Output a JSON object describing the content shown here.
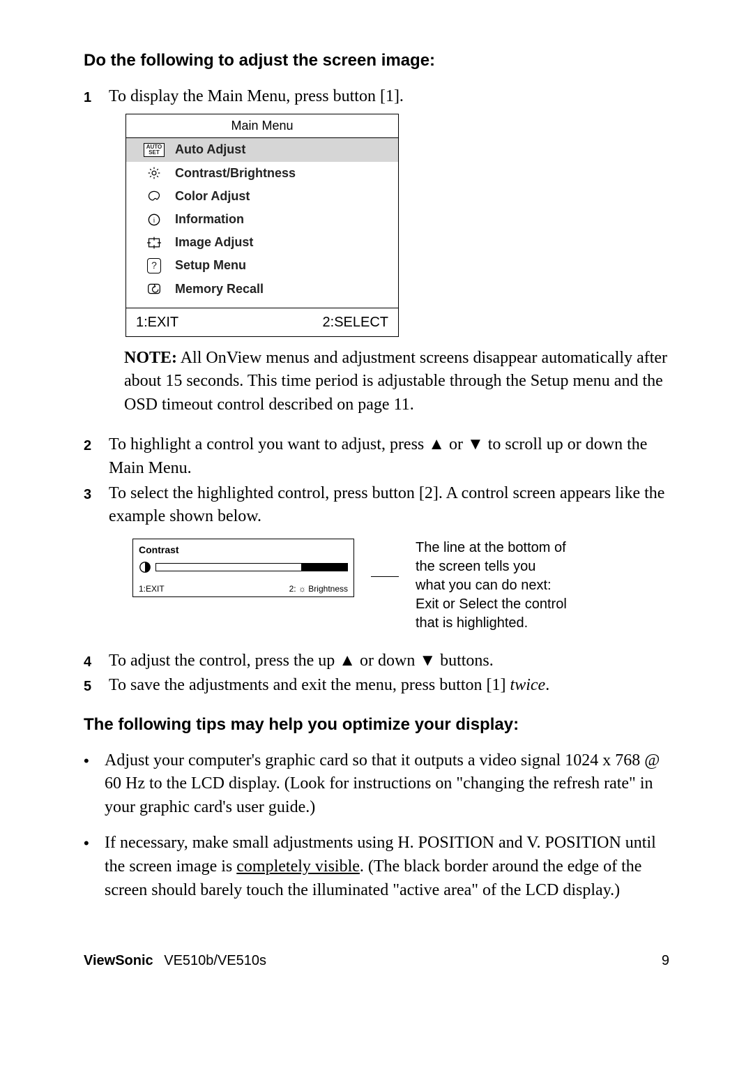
{
  "headings": {
    "adjust": "Do the following to adjust the screen image:",
    "tips": "The following tips may help you optimize your display:"
  },
  "steps": {
    "s1": {
      "num": "1",
      "text": "To display the Main Menu, press button [1]."
    },
    "s2": {
      "num": "2",
      "text": "To highlight a control you want to adjust, press ▲ or ▼ to scroll up or down the Main Menu."
    },
    "s3": {
      "num": "3",
      "text": "To select the highlighted control, press button [2]. A control screen appears like the example shown below."
    },
    "s4": {
      "num": "4",
      "text": "To adjust the control, press the up ▲ or down ▼ buttons."
    },
    "s5": {
      "num": "5",
      "pre": "To save the adjustments and exit the menu, press button [1] ",
      "italic": "twice",
      "post": "."
    }
  },
  "menu": {
    "title": "Main Menu",
    "items": {
      "auto": {
        "label": "Auto Adjust",
        "icon_top": "AUTO",
        "icon_bot": "SET"
      },
      "cb": {
        "label": "Contrast/Brightness"
      },
      "color": {
        "label": "Color Adjust"
      },
      "info": {
        "label": "Information"
      },
      "image": {
        "label": "Image Adjust"
      },
      "setup": {
        "label": "Setup Menu"
      },
      "mem": {
        "label": "Memory Recall"
      }
    },
    "footer": {
      "left": "1:EXIT",
      "right": "2:SELECT"
    }
  },
  "note": {
    "label": "NOTE:",
    "text": " All OnView menus and adjustment screens disappear automatically after about 15 seconds. This time period is adjustable through the Setup menu and the OSD timeout control described on page 11."
  },
  "contrast": {
    "title": "Contrast",
    "foot_left": "1:EXIT",
    "foot_right": "2: ☼ Brightness",
    "callout": "The line at the bottom of the screen tells you what you can do next: Exit or Select the control that is highlighted."
  },
  "bullets": {
    "b1": "Adjust your computer's graphic card so that it outputs a video signal 1024 x 768 @ 60 Hz to the LCD display. (Look for instructions on \"changing the refresh rate\" in your graphic card's user guide.)",
    "b2_pre": "If necessary, make small adjustments using H. POSITION and V. POSITION until the screen image is ",
    "b2_ul": "completely visible",
    "b2_post": ". (The black border around the edge of the screen should barely touch the illuminated \"active area\" of the LCD display.)"
  },
  "footer": {
    "brand": "ViewSonic",
    "model": "VE510b/VE510s",
    "page": "9"
  }
}
